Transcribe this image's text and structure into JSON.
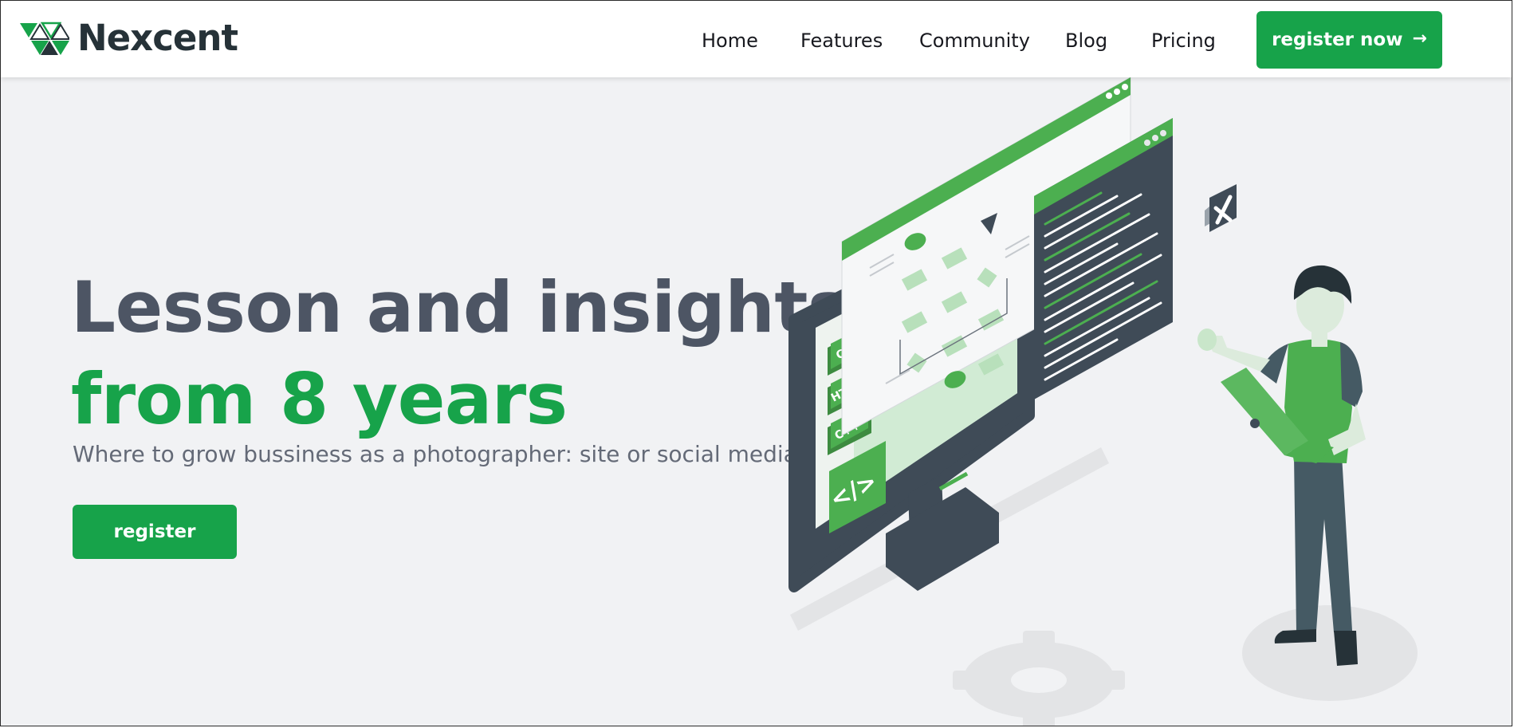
{
  "brand": {
    "name": "Nexcent"
  },
  "nav": {
    "items": [
      {
        "label": "Home"
      },
      {
        "label": "Features"
      },
      {
        "label": "Community"
      },
      {
        "label": "Blog"
      },
      {
        "label": "Pricing"
      }
    ],
    "cta_label": "register now",
    "cta_icon": "arrow-right-icon"
  },
  "hero": {
    "title_line1": "Lesson and insights",
    "title_line2": "from 8 years",
    "subtitle": "Where to grow bussiness as a photographer: site or social media?",
    "button_label": "register"
  },
  "illustration": {
    "badges": [
      "CSS",
      "HTML",
      "C++"
    ],
    "code_tag": "</>"
  },
  "colors": {
    "accent": "#17a34a",
    "heading": "#4d5564",
    "background": "#f1f2f4",
    "dark": "#263238"
  }
}
